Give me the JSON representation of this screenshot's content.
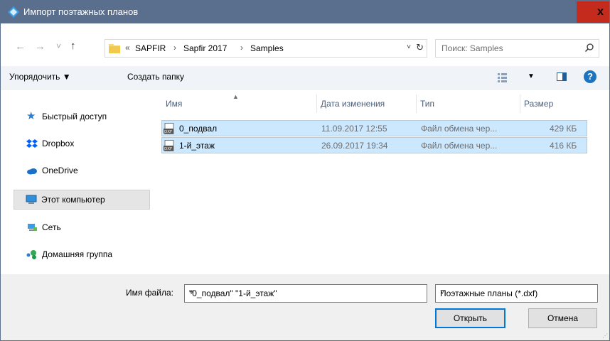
{
  "window": {
    "title": "Импорт поэтажных планов",
    "close": "x"
  },
  "nav": {
    "back": "←",
    "forward": "→",
    "history": "˅",
    "up": "↑",
    "path": [
      "«",
      "SAPFIR",
      "Sapfir 2017",
      "Samples"
    ],
    "path_dropdown": "˅",
    "search_placeholder": "Поиск: Samples"
  },
  "toolbar": {
    "organize": "Упорядочить ▼",
    "new_folder": "Создать папку",
    "view_dropdown": "▼"
  },
  "sidebar": {
    "items": [
      {
        "label": "Быстрый доступ",
        "icon": "star-icon"
      },
      {
        "label": "Dropbox",
        "icon": "dropbox-icon"
      },
      {
        "label": "OneDrive",
        "icon": "onedrive-icon"
      },
      {
        "label": "Этот компьютер",
        "icon": "computer-icon",
        "selected": true
      },
      {
        "label": "Сеть",
        "icon": "network-icon"
      },
      {
        "label": "Домашняя группа",
        "icon": "homegroup-icon"
      }
    ]
  },
  "columns": [
    "Имя",
    "Дата изменения",
    "Тип",
    "Размер"
  ],
  "files": [
    {
      "name": "0_подвал",
      "date": "11.09.2017 12:55",
      "type": "Файл обмена чер...",
      "size": "429 КБ"
    },
    {
      "name": "1-й_этаж",
      "date": "26.09.2017 19:34",
      "type": "Файл обмена чер...",
      "size": "416 КБ"
    }
  ],
  "bottom": {
    "filename_label": "Имя файла:",
    "filename_value": "\"0_подвал\" \"1-й_этаж\"",
    "filter": "Поэтажные планы (*.dxf)",
    "open": "Открыть",
    "cancel": "Отмена"
  },
  "colors": {
    "titlebar": "#5a6f8e",
    "close": "#c42b1c",
    "selection": "#cce8ff",
    "accent": "#0078d7"
  }
}
